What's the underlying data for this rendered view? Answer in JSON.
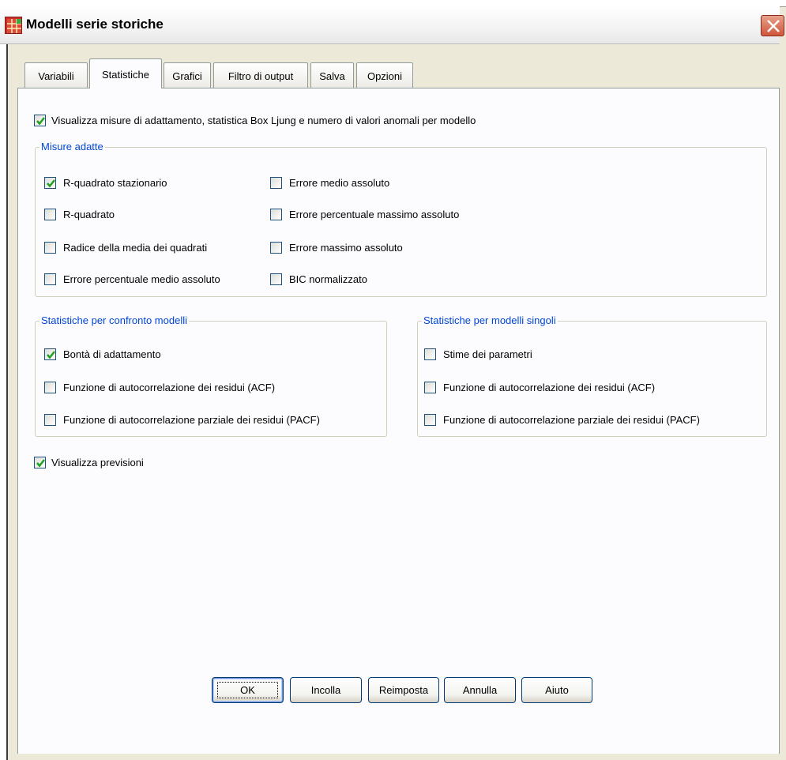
{
  "window": {
    "title": "Modelli serie storiche"
  },
  "tabs": [
    {
      "label": "Variabili"
    },
    {
      "label": "Statistiche"
    },
    {
      "label": "Grafici"
    },
    {
      "label": "Filtro di output"
    },
    {
      "label": "Salva"
    },
    {
      "label": "Opzioni"
    }
  ],
  "active_tab": "Statistiche",
  "display_fit": {
    "label": "Visualizza misure di adattamento, statistica Box Ljung e numero di valori anomali per modello",
    "checked": true
  },
  "fit_measures": {
    "legend": "Misure adatte",
    "items": [
      {
        "label": "R-quadrato stazionario",
        "checked": true
      },
      {
        "label": "R-quadrato",
        "checked": false
      },
      {
        "label": "Radice della media dei quadrati",
        "checked": false
      },
      {
        "label": "Errore percentuale medio assoluto",
        "checked": false
      },
      {
        "label": "Errore medio assoluto",
        "checked": false
      },
      {
        "label": "Errore percentuale massimo assoluto",
        "checked": false
      },
      {
        "label": "Errore massimo assoluto",
        "checked": false
      },
      {
        "label": "BIC normalizzato",
        "checked": false
      }
    ]
  },
  "compare_models": {
    "legend": "Statistiche per confronto modelli",
    "items": [
      {
        "label": "Bontà di adattamento",
        "checked": true
      },
      {
        "label": "Funzione di autocorrelazione dei residui (ACF)",
        "checked": false
      },
      {
        "label": "Funzione di autocorrelazione parziale dei residui (PACF)",
        "checked": false
      }
    ]
  },
  "single_models": {
    "legend": "Statistiche per modelli singoli",
    "items": [
      {
        "label": "Stime dei parametri",
        "checked": false
      },
      {
        "label": "Funzione di autocorrelazione dei residui (ACF)",
        "checked": false
      },
      {
        "label": "Funzione di autocorrelazione parziale dei residui (PACF)",
        "checked": false
      }
    ]
  },
  "display_forecasts": {
    "label": "Visualizza previsioni",
    "checked": true
  },
  "buttons": {
    "ok": "OK",
    "paste": "Incolla",
    "reset": "Reimposta",
    "cancel": "Annulla",
    "help": "Aiuto"
  },
  "colors": {
    "check": "#21a121",
    "group_legend": "#0046d5",
    "close_button": "#d0563b"
  }
}
